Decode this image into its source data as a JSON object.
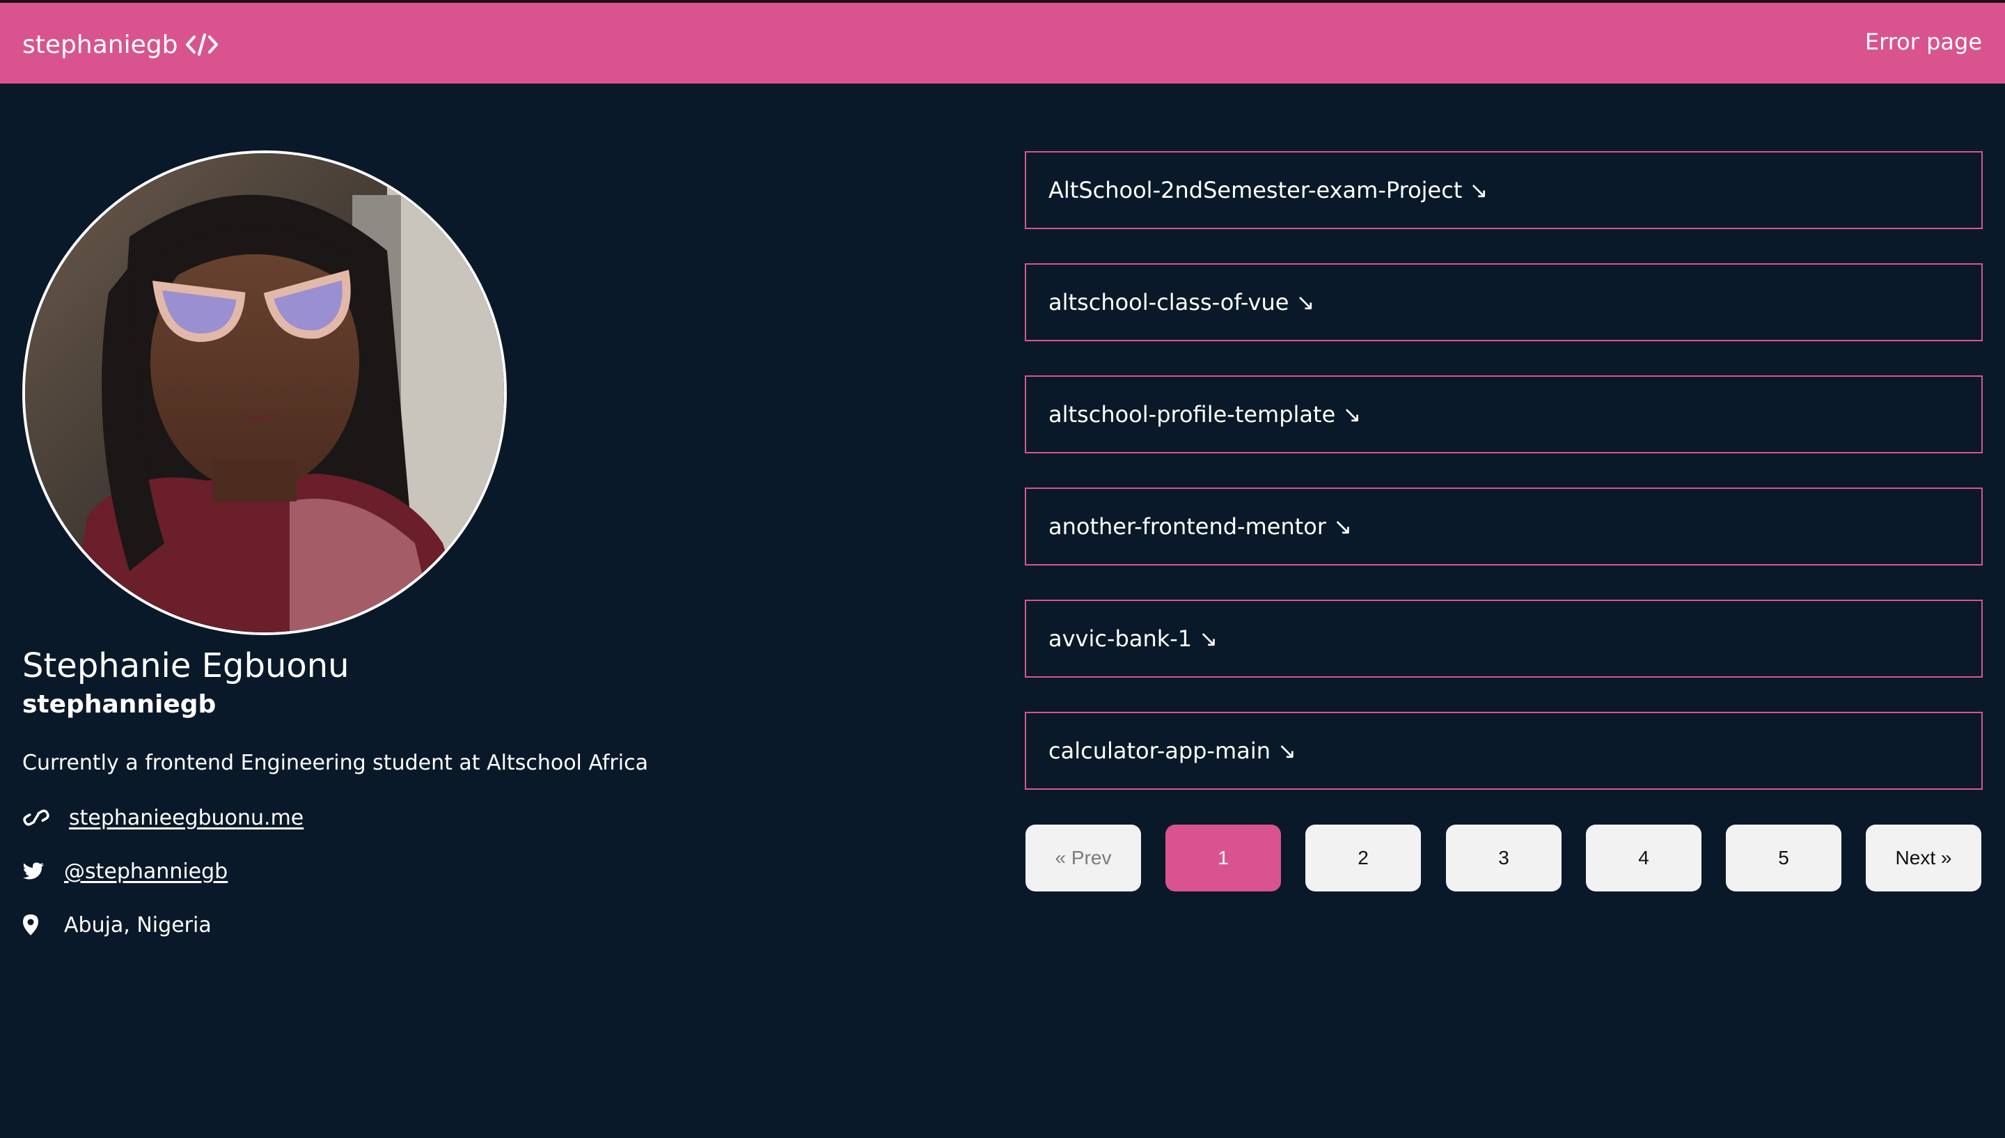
{
  "header": {
    "brand": "stephaniegb",
    "brand_icon": "code-icon",
    "nav_link": "Error page"
  },
  "profile": {
    "name": "Stephanie Egbuonu",
    "username": "stephanniegb",
    "bio": "Currently a frontend Engineering student at Altschool Africa",
    "website": "stephanieegbuonu.me",
    "twitter": "@stephanniegb",
    "location": "Abuja, Nigeria",
    "icons": {
      "website": "link-icon",
      "twitter": "twitter-icon",
      "location": "location-pin-icon"
    }
  },
  "repos": [
    {
      "label": "AltSchool-2ndSemester-exam-Project ↘"
    },
    {
      "label": "altschool-class-of-vue ↘"
    },
    {
      "label": "altschool-profile-template ↘"
    },
    {
      "label": "another-frontend-mentor ↘"
    },
    {
      "label": "avvic-bank-1 ↘"
    },
    {
      "label": "calculator-app-main ↘"
    }
  ],
  "pagination": {
    "prev": "« Prev",
    "pages": [
      "1",
      "2",
      "3",
      "4",
      "5"
    ],
    "current": "1",
    "next": "Next »"
  },
  "colors": {
    "accent": "#d9548f",
    "background": "#0a1929",
    "button": "#f2f2f2"
  }
}
